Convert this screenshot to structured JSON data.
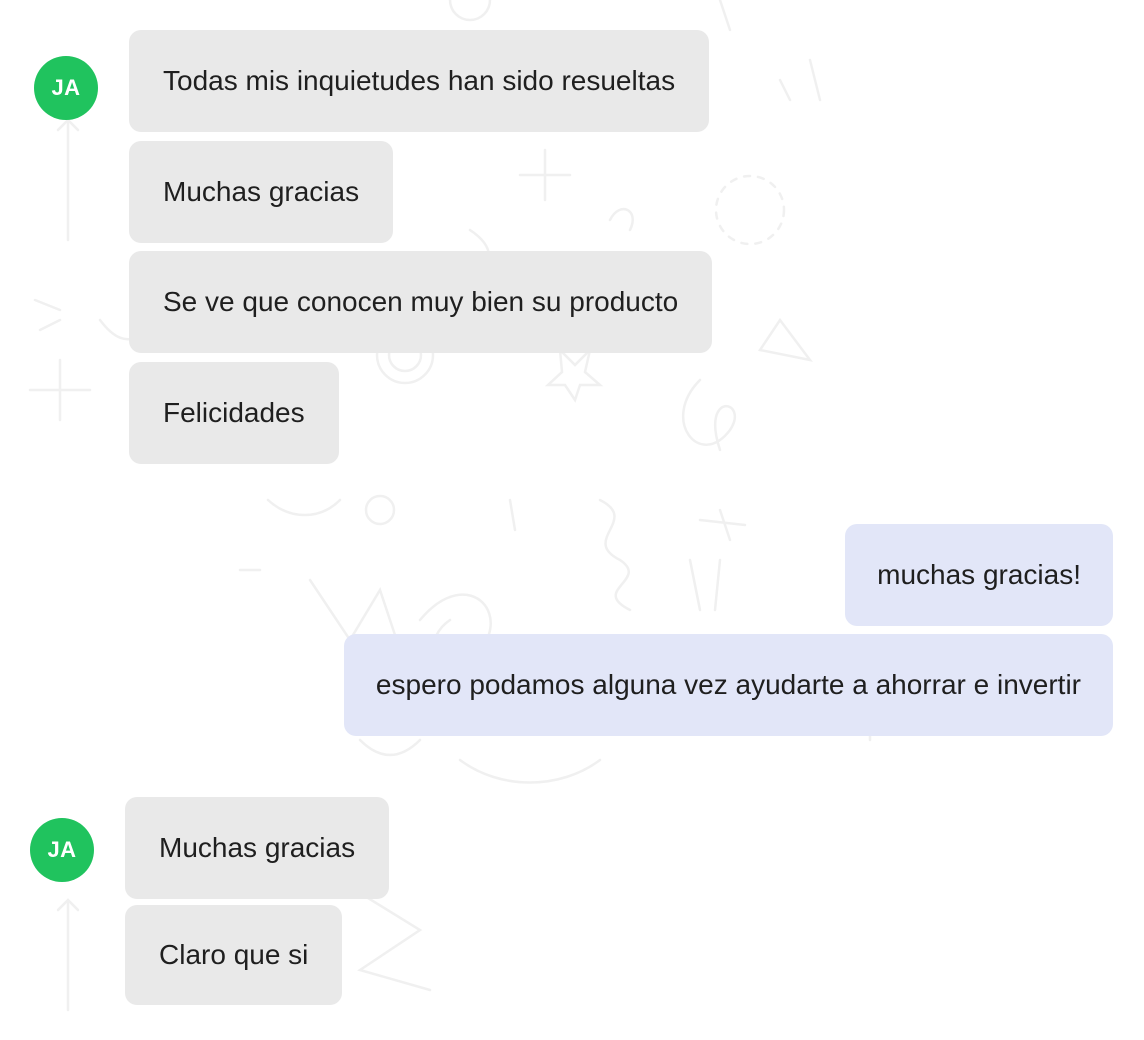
{
  "conversation": {
    "group1": {
      "sender_initials": "JA",
      "avatar_color": "#20c35e",
      "messages": [
        "Todas mis inquietudes han sido resueltas",
        "Muchas gracias",
        "Se ve que conocen muy bien su producto",
        "Felicidades"
      ]
    },
    "outgoing": {
      "bubble_color": "#e2e6f8",
      "messages": [
        "muchas gracias!",
        "espero podamos alguna vez ayudarte a ahorrar e invertir"
      ]
    },
    "group2": {
      "sender_initials": "JA",
      "avatar_color": "#20c35e",
      "messages": [
        "Muchas gracias",
        "Claro que si"
      ]
    }
  }
}
